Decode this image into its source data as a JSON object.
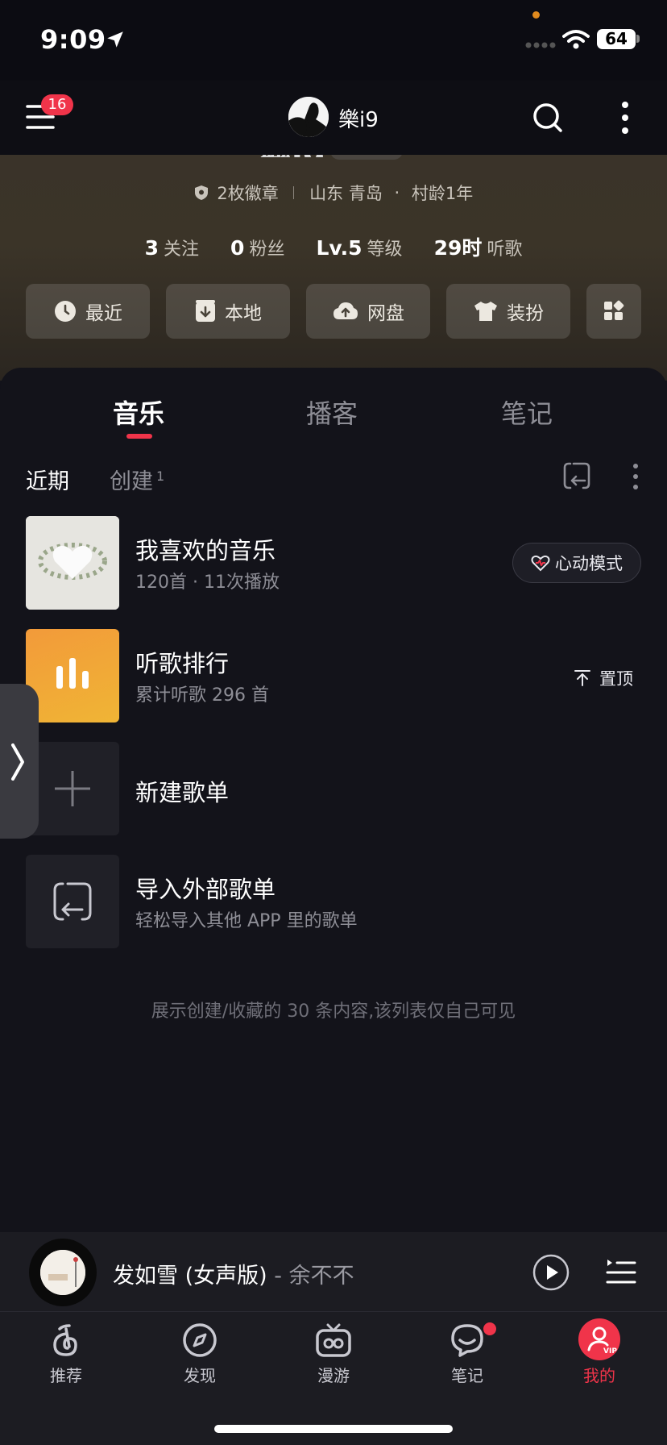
{
  "status_bar": {
    "time": "9:09",
    "battery": "64"
  },
  "header": {
    "menu_badge": "16",
    "username": "樂i9"
  },
  "profile": {
    "name": "樂i9",
    "badges": "2枚徽章",
    "location": "山东 青岛",
    "age": "村龄1年",
    "stats": [
      {
        "value": "3",
        "label": "关注"
      },
      {
        "value": "0",
        "label": "粉丝"
      },
      {
        "value": "Lv.5",
        "label": "等级"
      },
      {
        "value": "29时",
        "label": "听歌"
      }
    ],
    "quick_buttons": [
      {
        "label": "最近",
        "icon": "clock-icon"
      },
      {
        "label": "本地",
        "icon": "download-icon"
      },
      {
        "label": "网盘",
        "icon": "cloud-upload-icon"
      },
      {
        "label": "装扮",
        "icon": "tshirt-icon"
      },
      {
        "label": "",
        "icon": "grid-icon"
      }
    ]
  },
  "tabs": [
    "音乐",
    "播客",
    "笔记"
  ],
  "sub_tabs": {
    "recent": "近期",
    "created": "创建",
    "created_count": "1"
  },
  "playlists": [
    {
      "title": "我喜欢的音乐",
      "subtitle": "120首 · 11次播放",
      "action": "心动模式"
    },
    {
      "title": "听歌排行",
      "subtitle": "累计听歌 296 首",
      "action": "置顶"
    },
    {
      "title": "新建歌单",
      "subtitle": ""
    },
    {
      "title": "导入外部歌单",
      "subtitle": "轻松导入其他 APP 里的歌单"
    }
  ],
  "footnote": "展示创建/收藏的 30 条内容,该列表仅自己可见",
  "player": {
    "song": "发如雪 (女声版)",
    "artist": " - 余不不"
  },
  "nav": [
    {
      "label": "推荐",
      "icon": "netease-logo-icon"
    },
    {
      "label": "发现",
      "icon": "compass-icon"
    },
    {
      "label": "漫游",
      "icon": "radio-icon"
    },
    {
      "label": "笔记",
      "icon": "chat-bubble-icon"
    },
    {
      "label": "我的",
      "icon": "profile-vip-icon"
    }
  ],
  "colors": {
    "accent": "#f0344a",
    "background": "#13131a"
  }
}
